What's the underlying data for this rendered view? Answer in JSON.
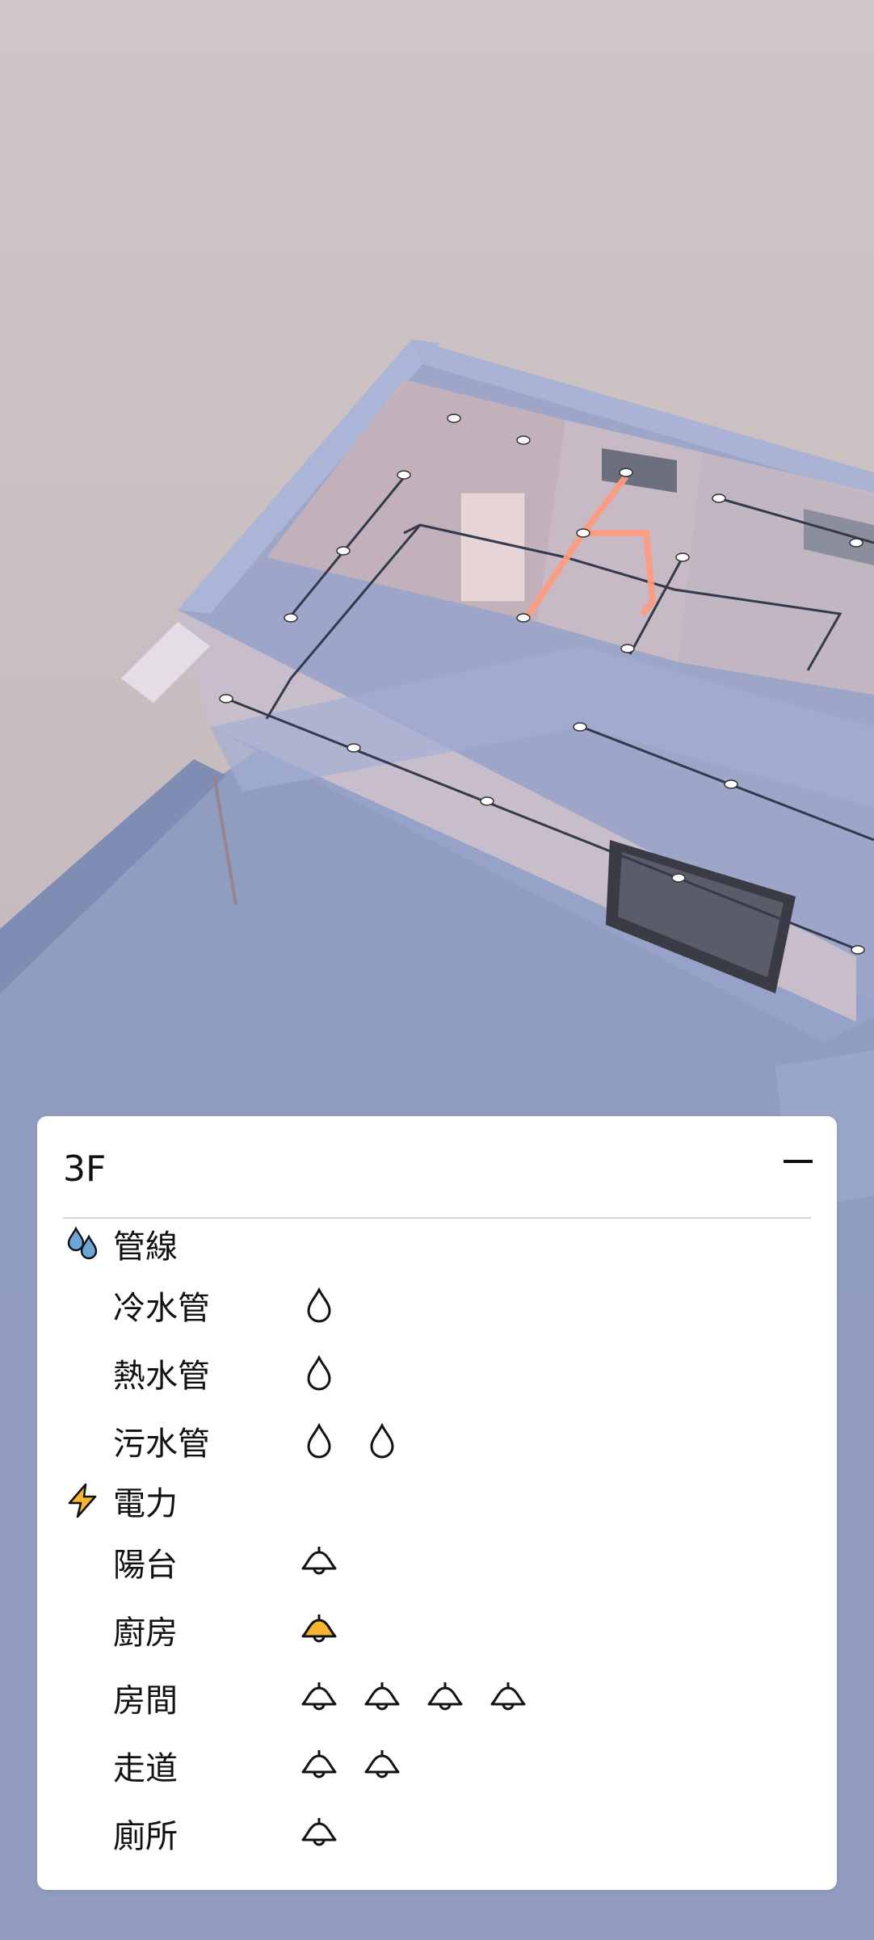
{
  "panel": {
    "floor": "3F",
    "categories": [
      {
        "label": "管線",
        "icon": "water-drops-icon",
        "color": "#6ea6d6",
        "items": [
          {
            "label": "冷水管",
            "icons": [
              "water-drop-icon"
            ]
          },
          {
            "label": "熱水管",
            "icons": [
              "water-drop-icon"
            ]
          },
          {
            "label": "污水管",
            "icons": [
              "water-drop-icon",
              "water-drop-icon"
            ]
          }
        ]
      },
      {
        "label": "電力",
        "icon": "lightning-icon",
        "color": "#f5b731",
        "items": [
          {
            "label": "陽台",
            "icons": [
              "lamp-icon"
            ]
          },
          {
            "label": "廚房",
            "icons": [
              "lamp-icon-active"
            ]
          },
          {
            "label": "房間",
            "icons": [
              "lamp-icon",
              "lamp-icon",
              "lamp-icon",
              "lamp-icon"
            ]
          },
          {
            "label": "走道",
            "icons": [
              "lamp-icon",
              "lamp-icon"
            ]
          },
          {
            "label": "廁所",
            "icons": [
              "lamp-icon"
            ]
          }
        ]
      }
    ]
  },
  "colors": {
    "active_lamp": "#f5b731",
    "pipe_hot": "#ff7a5a",
    "wall": "#8fa0cf"
  }
}
